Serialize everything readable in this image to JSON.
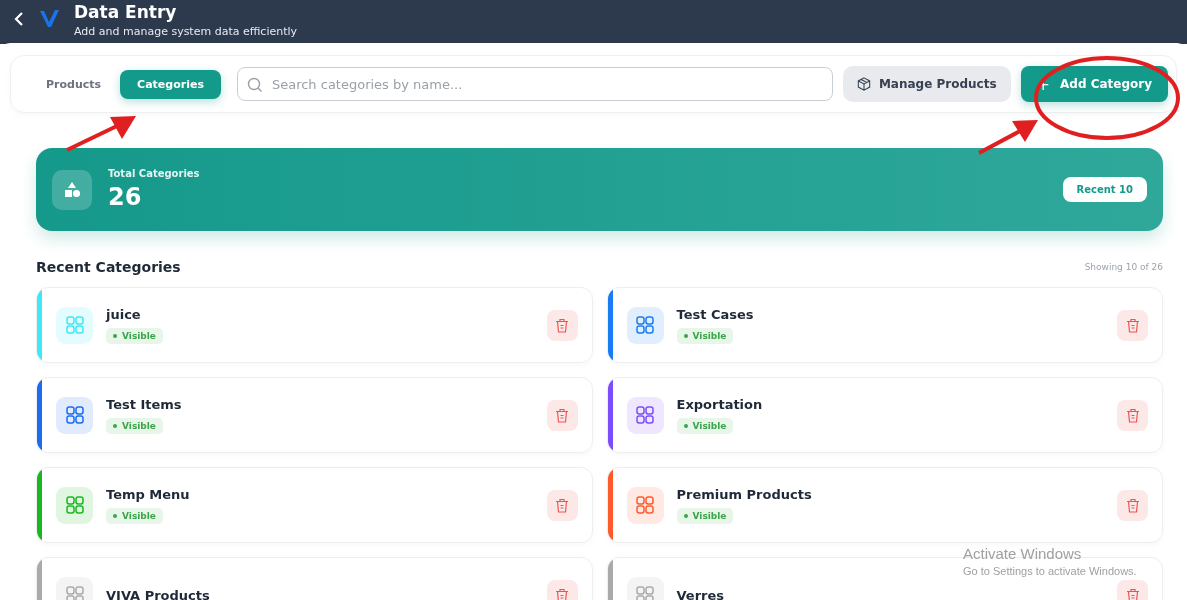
{
  "header": {
    "title": "Data Entry",
    "subtitle": "Add and manage system data efficiently"
  },
  "tabs": [
    {
      "label": "Products",
      "selected": false
    },
    {
      "label": "Categories",
      "selected": true
    }
  ],
  "search": {
    "placeholder": "Search categories by name..."
  },
  "actions": {
    "manage": "Manage Products",
    "add_icon": "+",
    "add": "Add Category"
  },
  "summary": {
    "label": "Total Categories",
    "value": "26",
    "badge": "Recent 10"
  },
  "section": {
    "title": "Recent Categories",
    "count": "Showing 10 of 26"
  },
  "categories": [
    {
      "name": "juice",
      "status": "Visible",
      "color": "#3ee8f5"
    },
    {
      "name": "Test Cases",
      "status": "Visible",
      "color": "#1a7cf5"
    },
    {
      "name": "Test Items",
      "status": "Visible",
      "color": "#1a6cf0"
    },
    {
      "name": "Exportation",
      "status": "Visible",
      "color": "#7c4dff"
    },
    {
      "name": "Temp Menu",
      "status": "Visible",
      "color": "#18b820"
    },
    {
      "name": "Premium Products",
      "status": "Visible",
      "color": "#ff5a2c"
    },
    {
      "name": "VIVA Products",
      "color": "#aaaaaa"
    },
    {
      "name": "Verres",
      "color": "#aaaaaa"
    }
  ],
  "os_notice": {
    "title": "Activate Windows",
    "text": "Go to Settings to activate Windows."
  }
}
